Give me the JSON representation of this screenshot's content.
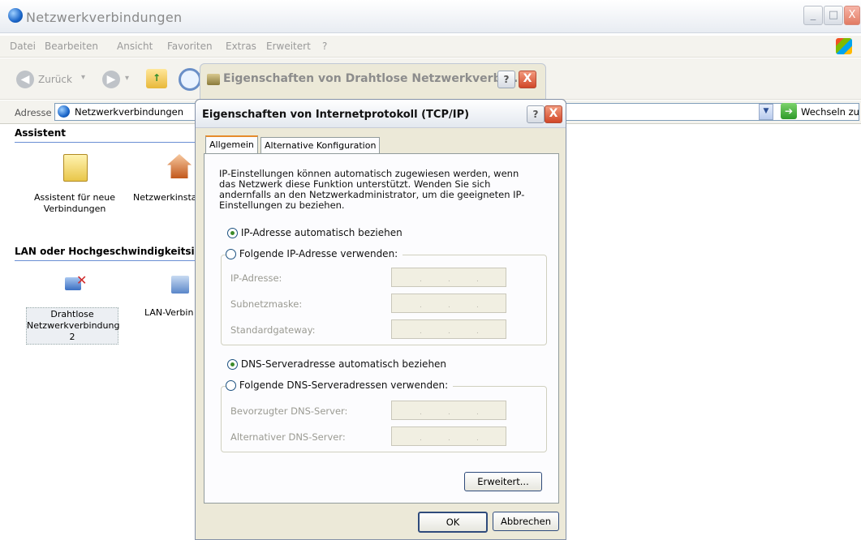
{
  "window": {
    "title": "Netzwerkverbindungen",
    "minimize_label": "_",
    "maximize_label": "□",
    "close_label": "X"
  },
  "menu": [
    "Datei",
    "Bearbeiten",
    "Ansicht",
    "Favoriten",
    "Extras",
    "Erweitert",
    "?"
  ],
  "toolbar": {
    "back_label": "Zurück",
    "forward_label": "",
    "search_label": ""
  },
  "address": {
    "label": "Adresse",
    "value": "Netzwerkverbindungen",
    "go_label": "Wechseln zu"
  },
  "left_pane": {
    "group1_title": "Assistent",
    "icon1_label": "Assistent für neue Verbindungen",
    "icon2_label": "Netzwerkinsta",
    "group2_title": "LAN oder Hochgeschwindigkeitsi",
    "icon3_label": "Drahtlose Netzwerkverbindung 2",
    "icon4_label": "LAN-Verbin"
  },
  "back_dialog": {
    "title": "Eigenschaften von Drahtlose Netzwerkverbi...",
    "help_label": "?",
    "close_label": "X"
  },
  "dialog": {
    "title": "Eigenschaften von Internetprotokoll (TCP/IP)",
    "help_label": "?",
    "close_label": "X",
    "tabs": [
      {
        "label": "Allgemein",
        "active": true
      },
      {
        "label": "Alternative Konfiguration",
        "active": false
      }
    ],
    "description": "IP-Einstellungen können automatisch zugewiesen werden, wenn das Netzwerk diese Funktion unterstützt. Wenden Sie sich andernfalls an den Netzwerkadministrator, um die geeigneten IP-Einstellungen zu beziehen.",
    "ip_auto_label": "IP-Adresse automatisch beziehen",
    "ip_manual_label": "Folgende IP-Adresse verwenden:",
    "ip_fields": {
      "ip_address": "IP-Adresse:",
      "subnet_mask": "Subnetzmaske:",
      "gateway": "Standardgateway:"
    },
    "dns_auto_label": "DNS-Serveradresse automatisch beziehen",
    "dns_manual_label": "Folgende DNS-Serveradressen verwenden:",
    "dns_fields": {
      "preferred": "Bevorzugter DNS-Server:",
      "alternate": "Alternativer DNS-Server:"
    },
    "advanced_button": "Erweitert...",
    "ok_button": "OK",
    "cancel_button": "Abbrechen",
    "ip_mode": "automatic",
    "dns_mode": "automatic"
  }
}
